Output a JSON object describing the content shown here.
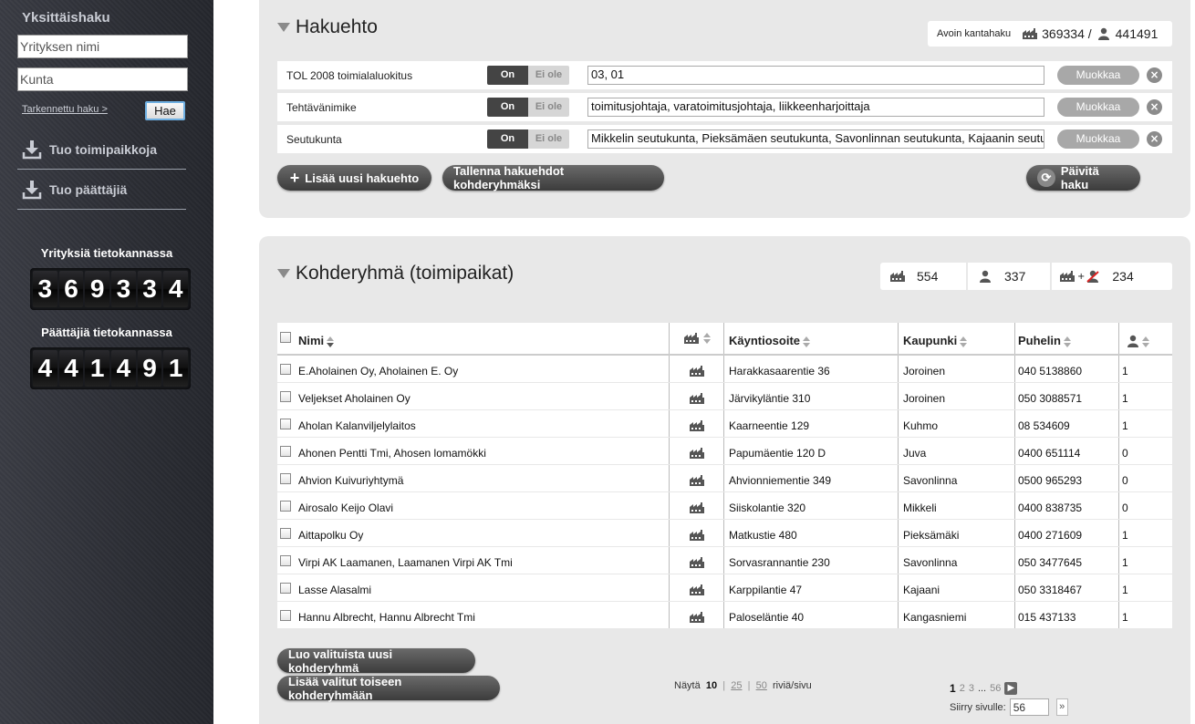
{
  "sidebar": {
    "title": "Yksittäishaku",
    "company_placeholder": "Yrityksen nimi",
    "city_placeholder": "Kunta",
    "advanced_link": "Tarkennettu haku >",
    "search_button": "Hae",
    "import_locations": "Tuo toimipaikkoja",
    "import_decision_makers": "Tuo päättäjiä",
    "companies_title": "Yrityksiä tietokannassa",
    "companies_digits": [
      "3",
      "6",
      "9",
      "3",
      "3",
      "4"
    ],
    "decision_makers_title": "Päättäjiä tietokannassa",
    "decision_makers_digits": [
      "4",
      "4",
      "1",
      "4",
      "9",
      "1"
    ]
  },
  "criteria": {
    "title": "Hakuehto",
    "open_search_label": "Avoin kantahaku",
    "location_count": "369334 /",
    "person_count": "441491",
    "rows": [
      {
        "name": "TOL 2008 toimialaluokitus",
        "on": "On",
        "off": "Ei ole",
        "value": "03, 01",
        "edit": "Muokkaa"
      },
      {
        "name": "Tehtävänimike",
        "on": "On",
        "off": "Ei ole",
        "value": "toimitusjohtaja, varatoimitusjohtaja, liikkeenharjoittaja",
        "edit": "Muokkaa"
      },
      {
        "name": "Seutukunta",
        "on": "On",
        "off": "Ei ole",
        "value": "Mikkelin seutukunta, Pieksämäen seutukunta, Savonlinnan seutukunta, Kajaanin seutukunta",
        "edit": "Muokkaa"
      }
    ],
    "add_button": "Lisää uusi hakuehto",
    "save_button": "Tallenna hakuehdot kohderyhmäksi",
    "refresh_button": "Päivitä haku"
  },
  "target": {
    "title": "Kohderyhmä (toimipaikat)",
    "count_locations": "554",
    "count_persons": "337",
    "count_excluded": "234",
    "columns": {
      "name": "Nimi",
      "address": "Käyntiosoite",
      "city": "Kaupunki",
      "phone": "Puhelin"
    },
    "rows": [
      {
        "name": "E.Aholainen Oy, Aholainen E. Oy",
        "address": "Harakkasaarentie 36",
        "city": "Joroinen",
        "phone": "040 5138860",
        "persons": "1"
      },
      {
        "name": "Veljekset Aholainen Oy",
        "address": "Järvikyläntie 310",
        "city": "Joroinen",
        "phone": "050 3088571",
        "persons": "1"
      },
      {
        "name": "Aholan Kalanviljelylaitos",
        "address": "Kaarneentie 129",
        "city": "Kuhmo",
        "phone": "08 534609",
        "persons": "1"
      },
      {
        "name": "Ahonen Pentti Tmi, Ahosen lomamökki",
        "address": "Papumäentie 120 D",
        "city": "Juva",
        "phone": "0400 651114",
        "persons": "0"
      },
      {
        "name": "Ahvion Kuivuriyhtymä",
        "address": "Ahvionniementie 349",
        "city": "Savonlinna",
        "phone": "0500 965293",
        "persons": "0"
      },
      {
        "name": "Airosalo Keijo Olavi",
        "address": "Siiskolantie 320",
        "city": "Mikkeli",
        "phone": "0400 838735",
        "persons": "0"
      },
      {
        "name": "Aittapolku Oy",
        "address": "Matkustie 480",
        "city": "Pieksämäki",
        "phone": "0400 271609",
        "persons": "1"
      },
      {
        "name": "Virpi AK Laamanen, Laamanen Virpi AK Tmi",
        "address": "Sorvasrannantie 230",
        "city": "Savonlinna",
        "phone": "050 3477645",
        "persons": "1"
      },
      {
        "name": "Lasse Alasalmi",
        "address": "Karppilantie 47",
        "city": "Kajaani",
        "phone": "050 3318467",
        "persons": "1"
      },
      {
        "name": "Hannu Albrecht, Hannu Albrecht Tmi",
        "address": "Paloseläntie 40",
        "city": "Kangasniemi",
        "phone": "015 437133",
        "persons": "1"
      }
    ],
    "create_group_button": "Luo valituista uusi kohderyhmä",
    "add_to_group_button": "Lisää valitut toiseen kohderyhmään",
    "show_label": "Näytä",
    "page_sizes": [
      "10",
      "25",
      "50"
    ],
    "rows_per_page": "riviä/sivu",
    "pages": [
      "1",
      "2",
      "3",
      "...",
      "56"
    ],
    "goto_label": "Siirry sivulle:",
    "goto_value": "56",
    "go_button": "»"
  }
}
